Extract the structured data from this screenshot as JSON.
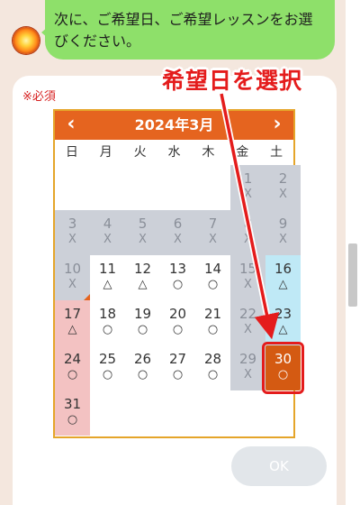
{
  "chat": {
    "bubble_text": "次に、ご希望日、ご希望レッスンをお選びください。"
  },
  "form": {
    "required_label": "※必須",
    "ok_label": "OK"
  },
  "annotation": {
    "text": "希望日を選択",
    "color": "#e41c1c"
  },
  "calendar": {
    "title": "2024年3月",
    "prev_icon": "chevron-left-icon",
    "next_icon": "chevron-right-icon",
    "weekdays": [
      "日",
      "月",
      "火",
      "水",
      "木",
      "金",
      "土"
    ],
    "days": [
      {
        "day": "1",
        "mark": "X",
        "col": 5,
        "row": 0,
        "style": "gray"
      },
      {
        "day": "2",
        "mark": "X",
        "col": 6,
        "row": 0,
        "style": "gray"
      },
      {
        "day": "3",
        "mark": "X",
        "col": 0,
        "row": 1,
        "style": "gray"
      },
      {
        "day": "4",
        "mark": "X",
        "col": 1,
        "row": 1,
        "style": "gray"
      },
      {
        "day": "5",
        "mark": "X",
        "col": 2,
        "row": 1,
        "style": "gray"
      },
      {
        "day": "6",
        "mark": "X",
        "col": 3,
        "row": 1,
        "style": "gray"
      },
      {
        "day": "7",
        "mark": "X",
        "col": 4,
        "row": 1,
        "style": "gray"
      },
      {
        "day": "8",
        "mark": "X",
        "col": 5,
        "row": 1,
        "style": "gray"
      },
      {
        "day": "9",
        "mark": "X",
        "col": 6,
        "row": 1,
        "style": "gray"
      },
      {
        "day": "10",
        "mark": "X",
        "col": 0,
        "row": 2,
        "style": "today"
      },
      {
        "day": "11",
        "mark": "△",
        "col": 1,
        "row": 2,
        "style": "open"
      },
      {
        "day": "12",
        "mark": "△",
        "col": 2,
        "row": 2,
        "style": "open"
      },
      {
        "day": "13",
        "mark": "○",
        "col": 3,
        "row": 2,
        "style": "open"
      },
      {
        "day": "14",
        "mark": "○",
        "col": 4,
        "row": 2,
        "style": "open"
      },
      {
        "day": "15",
        "mark": "X",
        "col": 5,
        "row": 2,
        "style": "gray"
      },
      {
        "day": "16",
        "mark": "△",
        "col": 6,
        "row": 2,
        "style": "sat-blue"
      },
      {
        "day": "17",
        "mark": "△",
        "col": 0,
        "row": 3,
        "style": "sun-red"
      },
      {
        "day": "18",
        "mark": "○",
        "col": 1,
        "row": 3,
        "style": "open"
      },
      {
        "day": "19",
        "mark": "○",
        "col": 2,
        "row": 3,
        "style": "open"
      },
      {
        "day": "20",
        "mark": "○",
        "col": 3,
        "row": 3,
        "style": "open"
      },
      {
        "day": "21",
        "mark": "○",
        "col": 4,
        "row": 3,
        "style": "open"
      },
      {
        "day": "22",
        "mark": "X",
        "col": 5,
        "row": 3,
        "style": "gray"
      },
      {
        "day": "23",
        "mark": "△",
        "col": 6,
        "row": 3,
        "style": "sat-blue"
      },
      {
        "day": "24",
        "mark": "○",
        "col": 0,
        "row": 4,
        "style": "sun-red"
      },
      {
        "day": "25",
        "mark": "○",
        "col": 1,
        "row": 4,
        "style": "open"
      },
      {
        "day": "26",
        "mark": "○",
        "col": 2,
        "row": 4,
        "style": "open"
      },
      {
        "day": "27",
        "mark": "○",
        "col": 3,
        "row": 4,
        "style": "open"
      },
      {
        "day": "28",
        "mark": "○",
        "col": 4,
        "row": 4,
        "style": "open"
      },
      {
        "day": "29",
        "mark": "X",
        "col": 5,
        "row": 4,
        "style": "gray"
      },
      {
        "day": "30",
        "mark": "○",
        "col": 6,
        "row": 4,
        "style": "selected"
      },
      {
        "day": "31",
        "mark": "○",
        "col": 0,
        "row": 5,
        "style": "sun-red"
      }
    ]
  }
}
